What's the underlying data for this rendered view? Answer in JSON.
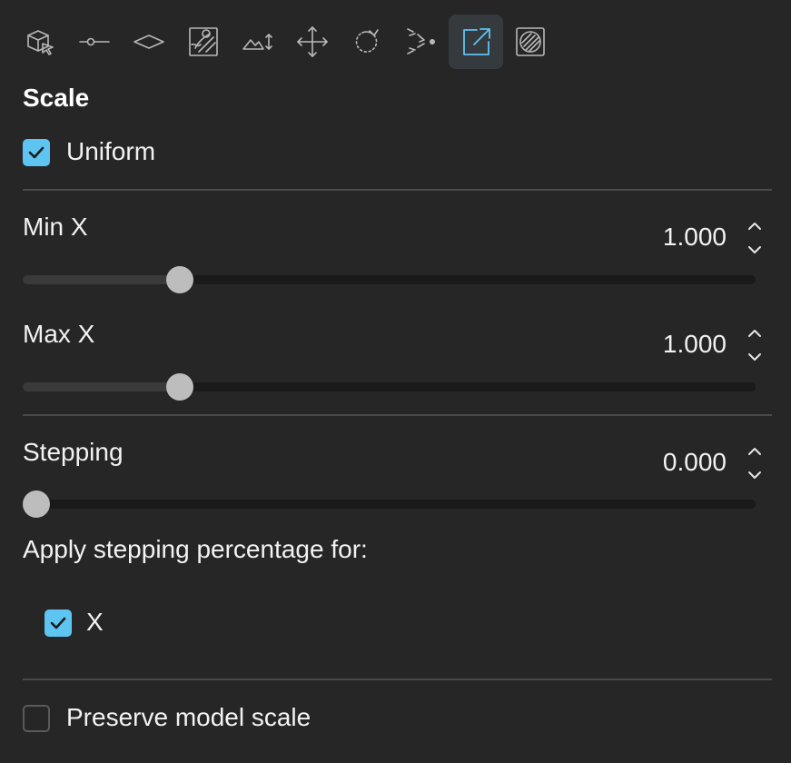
{
  "toolbar": {
    "tools": [
      {
        "icon": "cube-select-icon"
      },
      {
        "icon": "point-line-icon"
      },
      {
        "icon": "plane-diamond-icon"
      },
      {
        "icon": "paint-texture-icon"
      },
      {
        "icon": "terrain-height-icon"
      },
      {
        "icon": "move-arrows-icon"
      },
      {
        "icon": "rotate-icon"
      },
      {
        "icon": "scatter-converge-icon"
      },
      {
        "icon": "scale-expand-icon",
        "active": true
      },
      {
        "icon": "hatched-circle-icon"
      }
    ],
    "active_color": "#5ec4f2"
  },
  "section": {
    "title": "Scale"
  },
  "uniform": {
    "label": "Uniform",
    "checked": true
  },
  "min_x": {
    "label": "Min X",
    "value": "1.000",
    "slider_fraction": 0.214
  },
  "max_x": {
    "label": "Max X",
    "value": "1.000",
    "slider_fraction": 0.214
  },
  "stepping": {
    "label": "Stepping",
    "value": "0.000",
    "slider_fraction": 0.0,
    "apply_label": "Apply stepping percentage for:",
    "x_label": "X",
    "x_checked": true
  },
  "preserve": {
    "label": "Preserve model scale",
    "checked": false
  },
  "colors": {
    "accent": "#5ec4f2",
    "background": "#262626"
  }
}
